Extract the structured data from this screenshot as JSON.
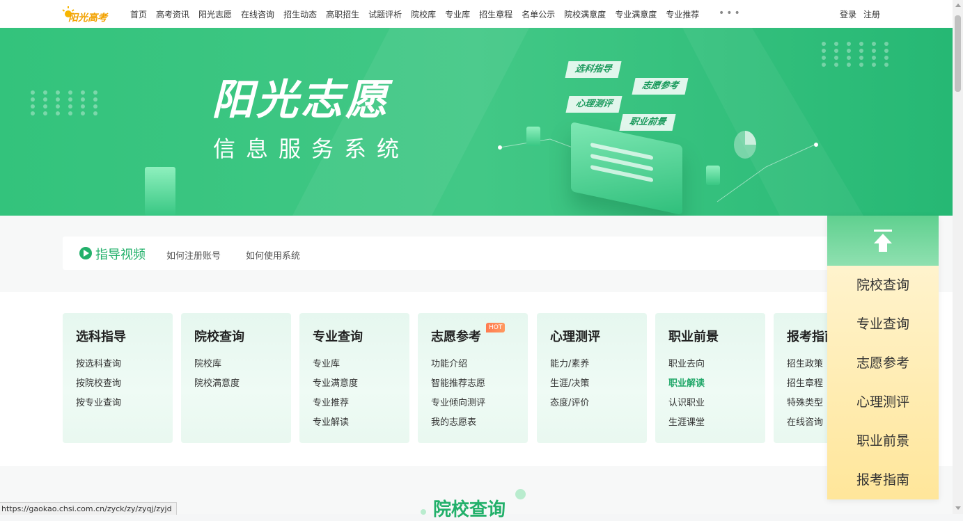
{
  "header": {
    "logo_text": "阳光高考",
    "nav": [
      "首页",
      "高考资讯",
      "阳光志愿",
      "在线咨询",
      "招生动态",
      "高职招生",
      "试题评析",
      "院校库",
      "专业库",
      "招生章程",
      "名单公示",
      "院校满意度",
      "专业满意度",
      "专业推荐"
    ],
    "more": "•••",
    "login": "登录",
    "register": "注册"
  },
  "banner": {
    "title": "阳光志愿",
    "subtitle": "信息服务系统",
    "chips": [
      "选科指导",
      "志愿参考",
      "心理测评",
      "职业前景"
    ]
  },
  "guide": {
    "title": "指导视频",
    "links": [
      "如何注册账号",
      "如何使用系统"
    ]
  },
  "cards": [
    {
      "title": "选科指导",
      "items": [
        "按选科查询",
        "按院校查询",
        "按专业查询"
      ]
    },
    {
      "title": "院校查询",
      "items": [
        "院校库",
        "院校满意度"
      ]
    },
    {
      "title": "专业查询",
      "items": [
        "专业库",
        "专业满意度",
        "专业推荐",
        "专业解读"
      ]
    },
    {
      "title": "志愿参考",
      "badge": "HOT",
      "items": [
        "功能介绍",
        "智能推荐志愿",
        "专业倾向测评",
        "我的志愿表"
      ]
    },
    {
      "title": "心理测评",
      "items": [
        "能力/素养",
        "生涯/决策",
        "态度/评价"
      ]
    },
    {
      "title": "职业前景",
      "items": [
        "职业去向",
        "职业解读",
        "认识职业",
        "生涯课堂"
      ]
    },
    {
      "title": "报考指南",
      "items": [
        "招生政策",
        "招生章程",
        "特殊类型",
        "在线咨询"
      ]
    }
  ],
  "section_title": "院校查询",
  "float_panel": {
    "items": [
      "院校查询",
      "专业查询",
      "志愿参考",
      "心理测评",
      "职业前景",
      "报考指南"
    ]
  },
  "status_url": "https://gaokao.chsi.com.cn/zyck/zy/zyqj/zyjd",
  "colors": {
    "primary": "#22b06a",
    "hot": "#ff7b50",
    "panel": "#ffe69a"
  }
}
